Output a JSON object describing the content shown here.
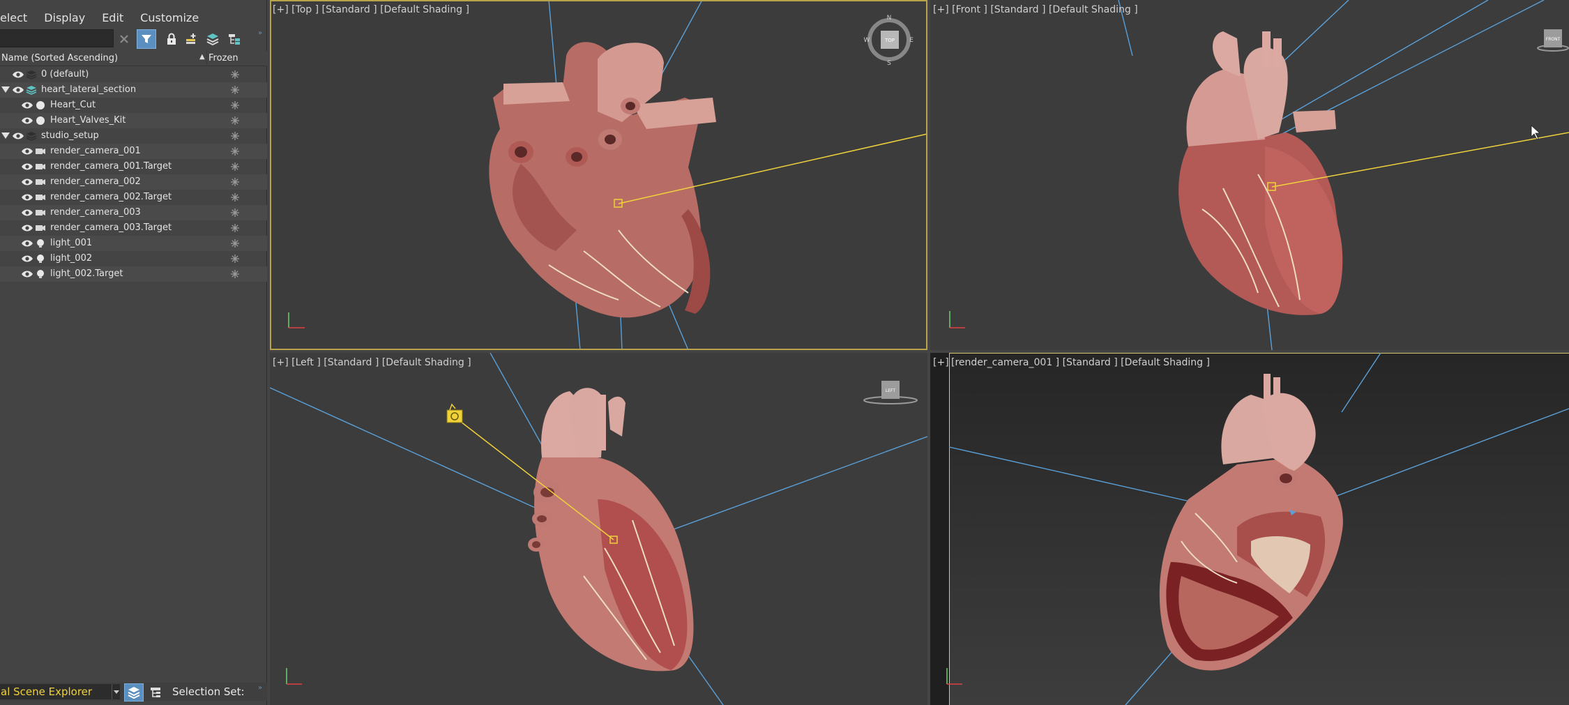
{
  "menubar": {
    "items": [
      "elect",
      "Display",
      "Edit",
      "Customize"
    ]
  },
  "toolbar": {
    "search_value": "",
    "icons": [
      "clear-icon",
      "filter-icon",
      "lock-icon",
      "add-layer-icon",
      "layers-icon",
      "hierarchy-icon"
    ]
  },
  "columns": {
    "name": "Name (Sorted Ascending)",
    "frozen": "Frozen"
  },
  "tree": [
    {
      "label": "0 (default)",
      "type": "layer",
      "level": 0,
      "expander": false
    },
    {
      "label": "heart_lateral_section",
      "type": "layer-active",
      "level": 0,
      "expander": true
    },
    {
      "label": "Heart_Cut",
      "type": "geometry",
      "level": 1,
      "expander": false
    },
    {
      "label": "Heart_Valves_Kit",
      "type": "geometry",
      "level": 1,
      "expander": false
    },
    {
      "label": "studio_setup",
      "type": "layer",
      "level": 0,
      "expander": true
    },
    {
      "label": "render_camera_001",
      "type": "camera",
      "level": 1,
      "expander": false
    },
    {
      "label": "render_camera_001.Target",
      "type": "camera",
      "level": 1,
      "expander": false
    },
    {
      "label": "render_camera_002",
      "type": "camera",
      "level": 1,
      "expander": false
    },
    {
      "label": "render_camera_002.Target",
      "type": "camera",
      "level": 1,
      "expander": false
    },
    {
      "label": "render_camera_003",
      "type": "camera",
      "level": 1,
      "expander": false
    },
    {
      "label": "render_camera_003.Target",
      "type": "camera",
      "level": 1,
      "expander": false
    },
    {
      "label": "light_001",
      "type": "light",
      "level": 1,
      "expander": false
    },
    {
      "label": "light_002",
      "type": "light",
      "level": 1,
      "expander": false
    },
    {
      "label": "light_002.Target",
      "type": "light",
      "level": 1,
      "expander": false
    }
  ],
  "bottombar": {
    "explorer_name": "al Scene Explorer",
    "selection_set_label": "Selection Set:"
  },
  "viewports": {
    "top": {
      "label": "[+] [Top ] [Standard ] [Default Shading ]",
      "cube_text": "TOP",
      "compass": [
        "N",
        "E",
        "S",
        "W"
      ]
    },
    "front": {
      "label": "[+] [Front ] [Standard ] [Default Shading ]",
      "cube_text": "FRONT"
    },
    "left": {
      "label": "[+] [Left ] [Standard ] [Default Shading ]",
      "cube_text": "LEFT"
    },
    "camera": {
      "label_plus": "[+]",
      "label": "[render_camera_001 ] [Standard ] [Default Shading ]"
    }
  },
  "colors": {
    "panel_bg": "#444444",
    "viewport_bg": "#3c3c3c",
    "active_border": "#b8a24a",
    "selection_yellow": "#f0d23a",
    "camera_line_blue": "#5aa0d8",
    "accent_blue": "#5b8fc0",
    "heart_flesh": "#c98178"
  }
}
